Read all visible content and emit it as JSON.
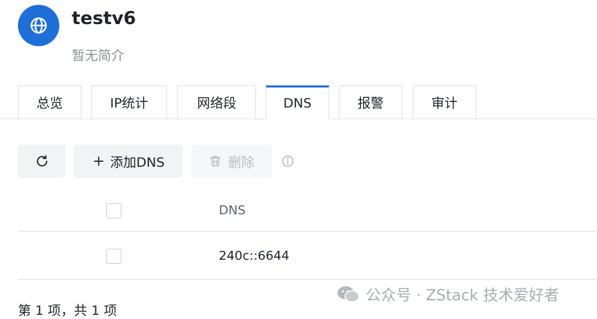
{
  "header": {
    "title": "testv6",
    "description": "暂无简介",
    "icon": "globe-icon",
    "accent_color": "#1f6fd8"
  },
  "tabs": [
    {
      "label": "总览",
      "active": false
    },
    {
      "label": "IP统计",
      "active": false
    },
    {
      "label": "网络段",
      "active": false
    },
    {
      "label": "DNS",
      "active": true
    },
    {
      "label": "报警",
      "active": false
    },
    {
      "label": "审计",
      "active": false
    }
  ],
  "toolbar": {
    "refresh_icon": "refresh-icon",
    "add_label": "添加DNS",
    "delete_label": "删除",
    "info_icon": "info-icon"
  },
  "table": {
    "columns": [
      "DNS"
    ],
    "rows": [
      {
        "dns": "240c::6644"
      }
    ]
  },
  "pagination": {
    "summary": "第 1 项，共 1 项"
  },
  "watermark": {
    "text": "公众号 · ZStack 技术爱好者"
  }
}
